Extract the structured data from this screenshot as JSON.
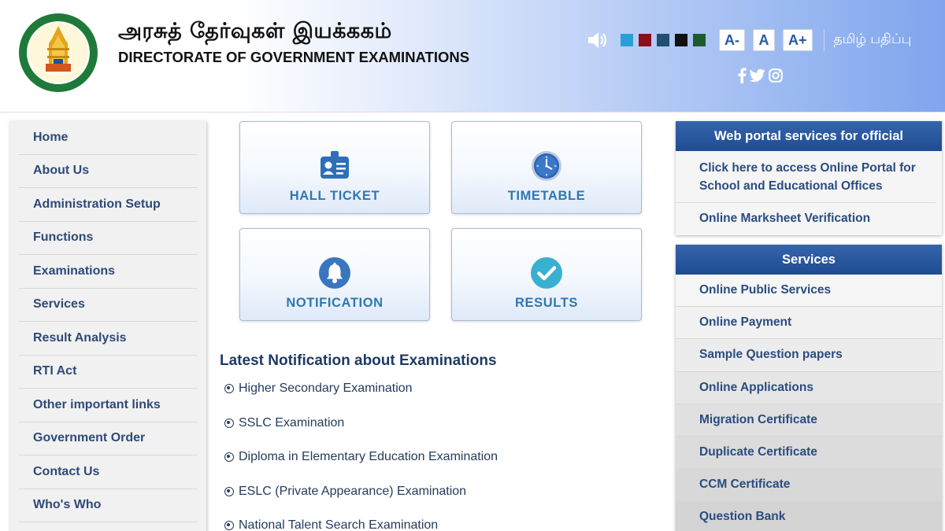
{
  "header": {
    "title_tamil": "அரசுத் தேர்வுகள் இயக்ககம்",
    "title_english": "DIRECTORATE OF GOVERNMENT EXAMINATIONS",
    "font_buttons": [
      "A-",
      "A",
      "A+"
    ],
    "language_link": "தமிழ் பதிப்பு",
    "theme_colors": [
      "#2a9fd6",
      "#8b0f1b",
      "#1f4f72",
      "#111111",
      "#1c5b2c"
    ],
    "icons": [
      "speaker-icon",
      "facebook-icon",
      "twitter-icon",
      "instagram-icon"
    ]
  },
  "sidebar": {
    "items": [
      "Home",
      "About Us",
      "Administration Setup",
      "Functions",
      "Examinations",
      "Services",
      "Result Analysis",
      "RTI Act",
      "Other important links",
      "Government Order",
      "Contact Us",
      "Who's Who"
    ]
  },
  "tiles": [
    {
      "label": "HALL TICKET",
      "icon": "id-card-icon"
    },
    {
      "label": "TIMETABLE",
      "icon": "clock-icon"
    },
    {
      "label": "NOTIFICATION",
      "icon": "bell-icon"
    },
    {
      "label": "RESULTS",
      "icon": "checkmark-icon"
    }
  ],
  "notifications": {
    "title": "Latest Notification about Examinations",
    "items": [
      "Higher Secondary Examination",
      "SSLC Examination",
      "Diploma in Elementary Education Examination",
      "ESLC (Private Appearance) Examination",
      "National Talent Search Examination"
    ]
  },
  "web_portal": {
    "title": "Web portal services for official",
    "items": [
      "Click here to access Online Portal for School and Educational Offices",
      "Online Marksheet Verification"
    ]
  },
  "services": {
    "title": "Services",
    "items": [
      "Online Public Services",
      "Online Payment",
      "Sample Question papers",
      "Online Applications",
      "Migration Certificate",
      "Duplicate Certificate",
      "CCM Certificate",
      "Question Bank"
    ]
  }
}
